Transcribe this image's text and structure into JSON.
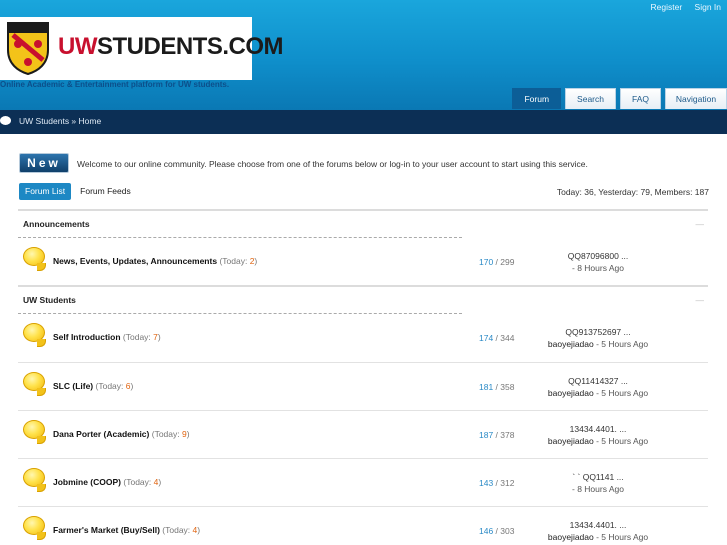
{
  "header": {
    "links": [
      "Register",
      "Sign In"
    ],
    "logo_text_uw": "UW",
    "logo_text_rest": "STUDENTS.COM",
    "tagline": "Online Academic & Entertainment platform for UW students.",
    "nav": [
      "Forum",
      "Search",
      "FAQ",
      "Navigation"
    ],
    "breadcrumb": "UW Students » Home"
  },
  "intro": {
    "badge": "New",
    "welcome": "Welcome to our online community. Please choose from one of the forums below or log-in to your user account to start using this service.",
    "tabs": [
      "Forum List",
      "Forum Feeds"
    ],
    "stats": "Today: 36, Yesterday: 79, Members: 187"
  },
  "sections": [
    {
      "title": "Announcements",
      "collapse": "—",
      "forums": [
        {
          "name": "News, Events, Updates, Announcements",
          "today_label": "(Today: ",
          "today": "2",
          "today_close": ")",
          "topics": "170",
          "posts": " / 299",
          "last_title": "QQ87096800 ...",
          "last_user": "",
          "last_ago": "- 8  Hours Ago"
        }
      ]
    },
    {
      "title": "UW Students",
      "collapse": "—",
      "forums": [
        {
          "name": "Self Introduction",
          "today_label": "(Today: ",
          "today": "7",
          "today_close": ")",
          "topics": "174",
          "posts": " / 344",
          "last_title": "QQ913752697 ...",
          "last_user": "baoyejiadao",
          "last_ago": " - 5  Hours Ago"
        },
        {
          "name": "SLC (Life)",
          "today_label": "(Today: ",
          "today": "6",
          "today_close": ")",
          "topics": "181",
          "posts": " / 358",
          "last_title": "QQ11414327 ...",
          "last_user": "baoyejiadao",
          "last_ago": " - 5  Hours Ago"
        },
        {
          "name": "Dana Porter (Academic)",
          "today_label": "(Today: ",
          "today": "9",
          "today_close": ")",
          "topics": "187",
          "posts": " / 378",
          "last_title": "13434.4401. ...",
          "last_user": "baoyejiadao",
          "last_ago": " - 5  Hours Ago"
        },
        {
          "name": "Jobmine (COOP)",
          "today_label": "(Today: ",
          "today": "4",
          "today_close": ")",
          "topics": "143",
          "posts": " / 312",
          "last_title": "` `   QQ1141 ...",
          "last_user": "",
          "last_ago": "- 8  Hours Ago"
        },
        {
          "name": "Farmer's Market (Buy/Sell)",
          "today_label": "(Today: ",
          "today": "4",
          "today_close": ")",
          "topics": "146",
          "posts": " / 303",
          "last_title": "13434.4401. ...",
          "last_user": "baoyejiadao",
          "last_ago": " - 5  Hours Ago"
        }
      ]
    }
  ]
}
